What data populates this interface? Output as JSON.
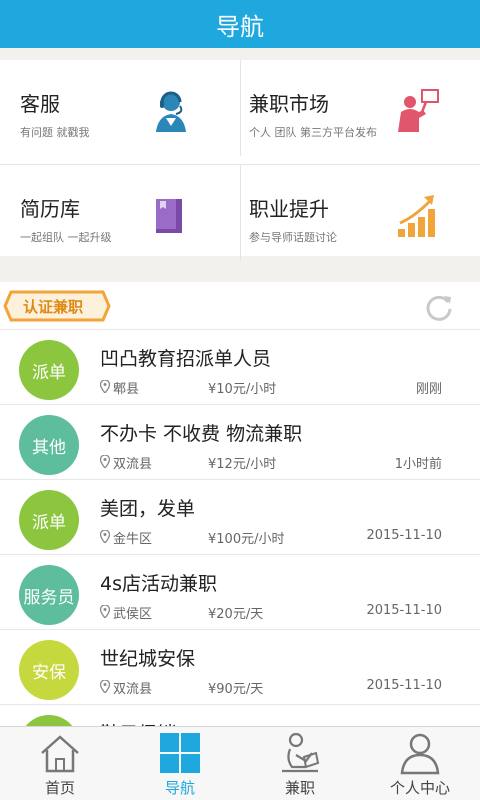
{
  "header": {
    "title": "导航"
  },
  "nav_grid": [
    {
      "title": "客服",
      "subtitle": "有问题 就戳我",
      "icon": "customer-service-icon"
    },
    {
      "title": "兼职市场",
      "subtitle": "个人 团队 第三方平台发布",
      "icon": "presenter-board-icon"
    },
    {
      "title": "简历库",
      "subtitle": "一起组队 一起升级",
      "icon": "resume-book-icon"
    },
    {
      "title": "职业提升",
      "subtitle": "参与导师话题讨论",
      "icon": "growth-chart-icon"
    }
  ],
  "list_header": {
    "badge": "认证兼职",
    "refresh_icon": "refresh-icon"
  },
  "jobs": [
    {
      "category": "派单",
      "color": "#8cc63f",
      "title": "凹凸教育招派单人员",
      "location": "郫县",
      "pay": "¥10元/小时",
      "time": "刚刚"
    },
    {
      "category": "其他",
      "color": "#5dbd9c",
      "title": "不办卡 不收费 物流兼职",
      "location": "双流县",
      "pay": "¥12元/小时",
      "time": "1小时前"
    },
    {
      "category": "派单",
      "color": "#8cc63f",
      "title": "美团，发单",
      "location": "金牛区",
      "pay": "¥100元/小时",
      "time": "2015-11-10"
    },
    {
      "category": "服务员",
      "color": "#5dbd9c",
      "title": "4s店活动兼职",
      "location": "武侯区",
      "pay": "¥20元/天",
      "time": "2015-11-10"
    },
    {
      "category": "安保",
      "color": "#c5d93f",
      "title": "世纪城安保",
      "location": "双流县",
      "pay": "¥90元/天",
      "time": "2015-11-10"
    },
    {
      "category": "",
      "color": "#8cc63f",
      "title": "鞋子促销",
      "location": "",
      "pay": "",
      "time": ""
    }
  ],
  "tabs": [
    {
      "label": "首页",
      "icon": "home-icon",
      "active": false
    },
    {
      "label": "导航",
      "icon": "grid-icon",
      "active": true
    },
    {
      "label": "兼职",
      "icon": "reading-person-icon",
      "active": false
    },
    {
      "label": "个人中心",
      "icon": "user-icon",
      "active": false
    }
  ],
  "colors": {
    "accent": "#1fa8dd",
    "badge_orange": "#f0a43a"
  }
}
